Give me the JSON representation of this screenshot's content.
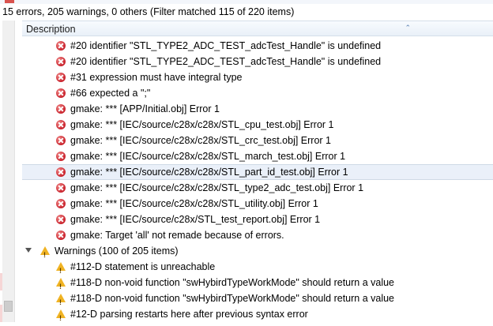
{
  "status_text": "15 errors, 205 warnings, 0 others (Filter matched 115 of 220 items)",
  "table": {
    "column_header": "Description"
  },
  "errors": [
    "#20 identifier \"STL_TYPE2_ADC_TEST_adcTest_Handle\" is undefined",
    "#20 identifier \"STL_TYPE2_ADC_TEST_adcTest_Handle\" is undefined",
    "#31 expression must have integral type",
    "#66 expected a \";\"",
    "gmake: *** [APP/Initial.obj] Error 1",
    "gmake: *** [IEC/source/c28x/c28x/STL_cpu_test.obj] Error 1",
    "gmake: *** [IEC/source/c28x/c28x/STL_crc_test.obj] Error 1",
    "gmake: *** [IEC/source/c28x/c28x/STL_march_test.obj] Error 1",
    "gmake: *** [IEC/source/c28x/c28x/STL_part_id_test.obj] Error 1",
    "gmake: *** [IEC/source/c28x/c28x/STL_type2_adc_test.obj] Error 1",
    "gmake: *** [IEC/source/c28x/c28x/STL_utility.obj] Error 1",
    "gmake: *** [IEC/source/c28x/STL_test_report.obj] Error 1",
    "gmake: Target 'all' not remade because of errors."
  ],
  "warnings_group": {
    "label": "Warnings (100 of 205 items)"
  },
  "warnings": [
    "#112-D statement is unreachable",
    "#118-D non-void function \"swHybirdTypeWorkMode\" should return a value",
    "#118-D non-void function \"swHybirdTypeWorkMode\" should return a value",
    "#12-D parsing restarts here after previous syntax error"
  ],
  "icons": {
    "error": "error-icon",
    "warning": "warning-icon",
    "collapse": "expand-arrow-icon"
  },
  "colors": {
    "error": "#c8202a",
    "warning": "#f0b323",
    "header_bg": "#e9f0f8",
    "selected_row_bg": "#eaf0f9"
  }
}
